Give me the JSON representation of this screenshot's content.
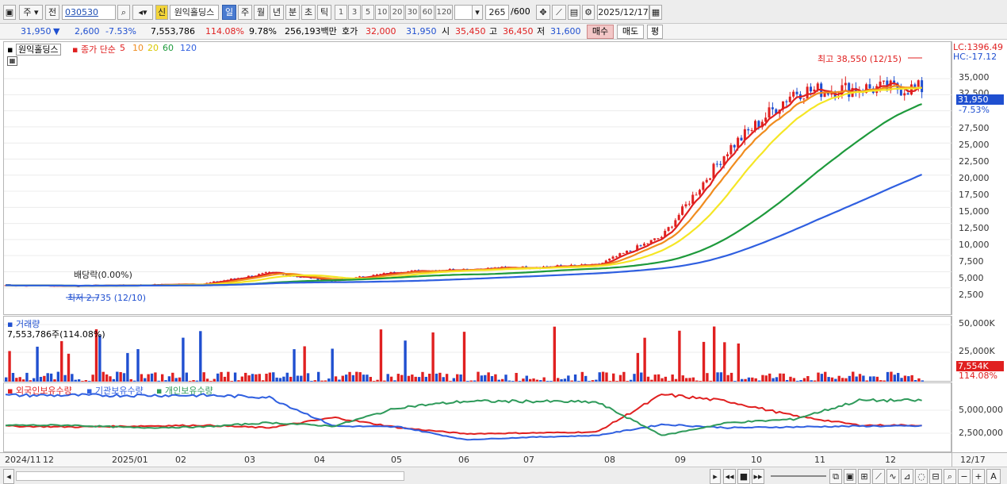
{
  "toolbar": {
    "period_type": "주",
    "prev_label": "전",
    "code": "030530",
    "credit_badge": "신",
    "stock_name": "원익홀딩스",
    "periods": [
      "일",
      "주",
      "월",
      "년",
      "분",
      "초",
      "틱"
    ],
    "intervals": [
      "1",
      "3",
      "5",
      "10",
      "20",
      "30",
      "60",
      "120"
    ],
    "count": "265",
    "count_total": "/600",
    "date": "2025/12/17"
  },
  "quote": {
    "price": "31,950",
    "arrow": "▼",
    "change": "2,600",
    "change_pct": "-7.53%",
    "volume": "7,553,786",
    "volume_ratio": "114.08%",
    "turnover": "9.78%",
    "amount": "256,193백만",
    "bid_label": "호가",
    "bid": "32,000",
    "ask": "31,950",
    "open_label": "시",
    "open": "35,450",
    "high_label": "고",
    "high": "36,450",
    "low_label": "저",
    "low": "31,600",
    "buy_label": "매수",
    "sell_label": "매도",
    "eval_label": "평"
  },
  "price_pane": {
    "legend_name": "원익홀딩스",
    "legend_ma": "종가 단순",
    "ma_periods": [
      "5",
      "10",
      "20",
      "60",
      "120"
    ],
    "high_note": "최고 38,550 (12/15)",
    "low_note": "최저 2,735 (12/10)",
    "dividend_note": "배당락(0.00%)",
    "lc": "LC:1396.49",
    "hc": "HC:-17.12",
    "current_tag": "31,950",
    "current_pct": "-7.53%",
    "yticks": [
      "35,000",
      "32,500",
      "27,500",
      "25,000",
      "22,500",
      "20,000",
      "17,500",
      "15,000",
      "12,500",
      "10,000",
      "7,500",
      "5,000",
      "2,500"
    ]
  },
  "volume_pane": {
    "title": "거래량",
    "subtitle": "7,553,786주(114.08%)",
    "yticks": [
      "50,000K",
      "25,000K"
    ],
    "current_tag": "7,554K",
    "current_pct": "114.08%"
  },
  "holding_pane": {
    "legend": [
      "외국인보유수량",
      "기관보유수량",
      "개인보유수량"
    ],
    "yticks": [
      "5,000,000",
      "2,500,000"
    ]
  },
  "xaxis": {
    "labels": [
      "2024/11",
      "12",
      "2025/01",
      "02",
      "03",
      "04",
      "05",
      "06",
      "07",
      "08",
      "09",
      "10",
      "11",
      "12"
    ],
    "right_label": "12/17"
  },
  "colors": {
    "up": "#e02020",
    "down": "#1f4fd0",
    "ma5": "#e02020",
    "ma10": "#f08c1e",
    "ma20": "#f5e625",
    "ma60": "#1e9a3c",
    "ma120": "#2f5fe0",
    "foreign": "#e02020",
    "institution": "#2f5fe0",
    "individual": "#2e9a5a"
  },
  "chart_data": {
    "type": "line",
    "title": "원익홀딩스",
    "x": [
      "2024-11",
      "2024-12",
      "2025-01",
      "2025-02",
      "2025-03",
      "2025-04",
      "2025-05",
      "2025-06",
      "2025-07",
      "2025-08",
      "2025-09",
      "2025-10",
      "2025-11",
      "2025-12"
    ],
    "series": [
      {
        "name": "5",
        "values": [
          2900,
          2800,
          2900,
          3100,
          4800,
          3600,
          5000,
          5400,
          5700,
          6000,
          10500,
          24000,
          33000,
          33500
        ]
      },
      {
        "name": "120",
        "values": [
          2900,
          2950,
          3000,
          3100,
          3300,
          3600,
          4000,
          4300,
          4600,
          4900,
          6000,
          9000,
          13500,
          16000
        ]
      }
    ],
    "ylim": [
      0,
      40000
    ]
  }
}
